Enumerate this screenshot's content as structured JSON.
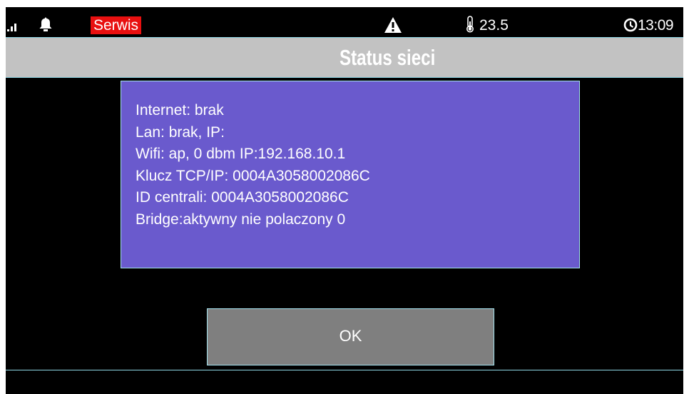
{
  "statusbar": {
    "signal_icon": "signal-bars-icon",
    "bell_icon": "bell-icon",
    "service_badge": "Serwis",
    "service_badge_color": "#e81010",
    "warning_icon": "warning-triangle-icon",
    "thermometer_icon": "thermometer-icon",
    "temperature": "23.5",
    "clock_icon": "clock-icon",
    "time": "13:09"
  },
  "title": {
    "text": "Status sieci",
    "background": "#c2c2c2"
  },
  "panel": {
    "background": "#6a5acd",
    "lines": [
      "Internet: brak",
      "Lan: brak, IP:",
      "Wifi: ap, 0 dbm IP:192.168.10.1",
      "Klucz TCP/IP: 0004A3058002086C",
      "ID centrali: 0004A3058002086C",
      "Bridge:aktywny nie polaczony 0"
    ]
  },
  "dialog": {
    "ok_label": "OK"
  }
}
